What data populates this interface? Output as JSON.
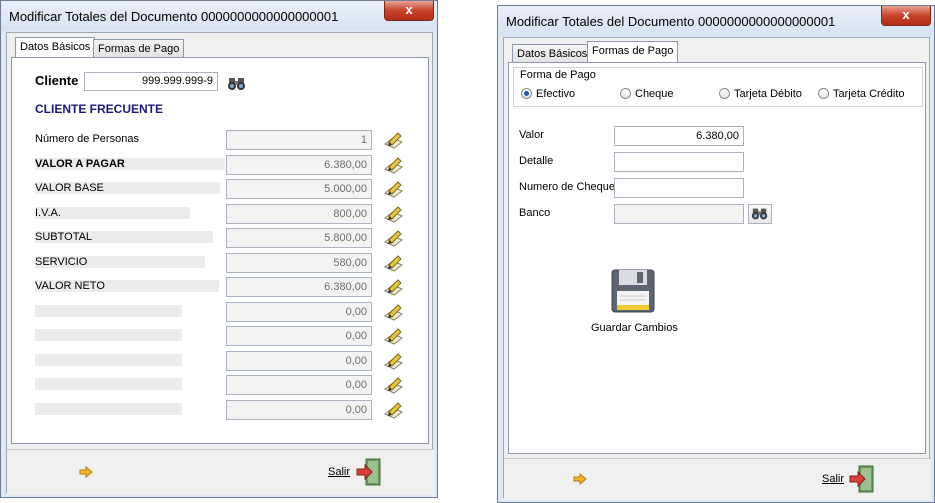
{
  "window1": {
    "title": "Modificar Totales del Documento 0000000000000000001",
    "close_glyph": "x",
    "tabs": [
      {
        "label": "Datos Básicos",
        "active": true
      },
      {
        "label": "Formas de Pago",
        "active": false
      }
    ],
    "cliente_label": "Cliente",
    "cliente_value": "999.999.999-9",
    "cliente_frecuente": "CLIENTE FRECUENTE",
    "rows": [
      {
        "label": "Número de Personas",
        "value": "1"
      },
      {
        "label": "VALOR A PAGAR",
        "value": "6.380,00"
      },
      {
        "label": "VALOR BASE",
        "value": "5.000,00"
      },
      {
        "label": "I.V.A.",
        "value": "800,00"
      },
      {
        "label": "SUBTOTAL",
        "value": "5.800,00"
      },
      {
        "label": "SERVICIO",
        "value": "580,00"
      },
      {
        "label": "VALOR NETO",
        "value": "6.380,00"
      },
      {
        "label": "",
        "value": "0,00"
      },
      {
        "label": "",
        "value": "0,00"
      },
      {
        "label": "",
        "value": "0,00"
      },
      {
        "label": "",
        "value": "0,00"
      },
      {
        "label": "",
        "value": "0,00"
      }
    ],
    "salir_label": "Salir"
  },
  "window2": {
    "title": "Modificar Totales del Documento 0000000000000000001",
    "close_glyph": "x",
    "tabs": [
      {
        "label": "Datos Básicos",
        "active": false
      },
      {
        "label": "Formas de Pago",
        "active": true
      }
    ],
    "forma_de_pago_label": "Forma de Pago",
    "radios": [
      {
        "label": "Efectivo",
        "selected": true
      },
      {
        "label": "Cheque",
        "selected": false
      },
      {
        "label": "Tarjeta Débito",
        "selected": false
      },
      {
        "label": "Tarjeta Crédito",
        "selected": false
      }
    ],
    "valor_label": "Valor",
    "valor_value": "6.380,00",
    "detalle_label": "Detalle",
    "detalle_value": "",
    "numero_cheque_label": "Numero de Cheque",
    "numero_cheque_value": "",
    "banco_label": "Banco",
    "banco_value": "",
    "guardar_label": "Guardar Cambios",
    "salir_label": "Salir"
  },
  "icons": {
    "binoculars": "binoculars-icon",
    "edit": "pencil-paper-icon",
    "save": "floppy-disk-icon",
    "exit": "exit-door-icon",
    "arrow": "arrow-right-icon"
  },
  "colors": {
    "cliente_frecuente": "#1a1a7a",
    "close_button": "#c8432b"
  }
}
